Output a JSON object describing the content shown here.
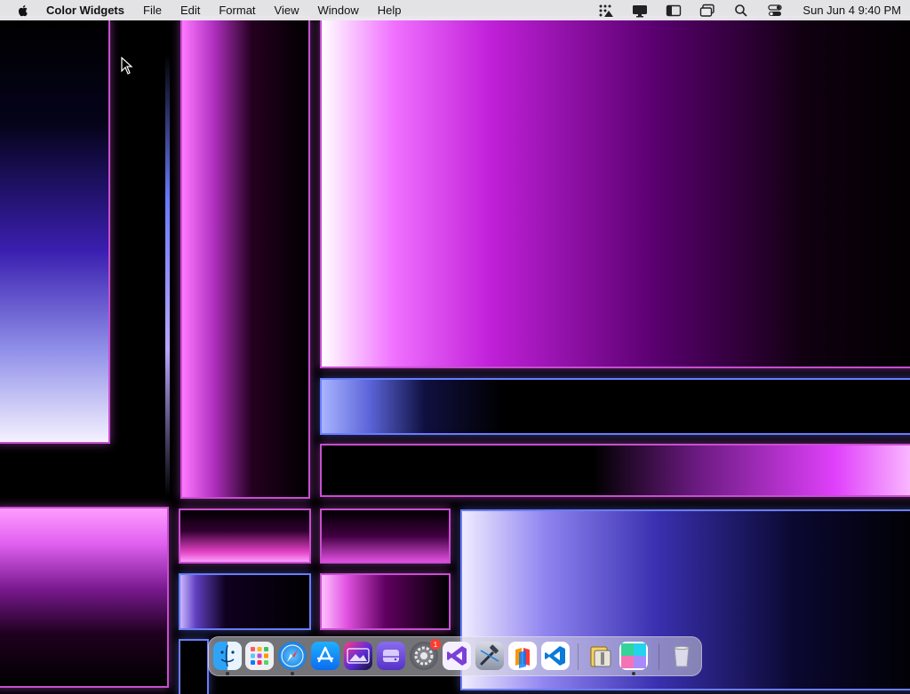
{
  "menubar": {
    "app_name": "Color Widgets",
    "menus": [
      "File",
      "Edit",
      "Format",
      "View",
      "Window",
      "Help"
    ],
    "status_icons": [
      "widget-grid-icon",
      "display-icon",
      "sidebar-icon",
      "window-stack-icon",
      "search-icon",
      "control-center-icon"
    ],
    "clock": "Sun Jun 4  9:40 PM"
  },
  "dock": {
    "apps": [
      {
        "name": "Finder",
        "icon": "finder-icon",
        "running": true
      },
      {
        "name": "Launchpad",
        "icon": "launchpad-icon",
        "running": false
      },
      {
        "name": "Safari",
        "icon": "safari-icon",
        "running": true
      },
      {
        "name": "App Store",
        "icon": "app-store-icon",
        "running": false
      },
      {
        "name": "Photo Editor HD",
        "icon": "photo-hd-icon",
        "running": false
      },
      {
        "name": "Storage",
        "icon": "disk-icon",
        "running": false
      },
      {
        "name": "System Settings",
        "icon": "gear-icon",
        "running": false,
        "badge": "1"
      },
      {
        "name": "Visual Studio",
        "icon": "visual-studio-icon",
        "running": false
      },
      {
        "name": "Xcode Tools",
        "icon": "hammer-icon",
        "running": false
      },
      {
        "name": "Books",
        "icon": "books-icon",
        "running": false
      },
      {
        "name": "VS Code",
        "icon": "vscode-icon",
        "running": false
      },
      {
        "name": "Archive Utility",
        "icon": "archive-icon",
        "running": false
      },
      {
        "name": "Color Widgets",
        "icon": "color-widgets-icon",
        "running": true
      },
      {
        "name": "Trash",
        "icon": "trash-icon",
        "running": false
      }
    ]
  },
  "colors": {
    "pink": "#e040fb",
    "violet": "#6a3df0",
    "blue": "#6a7cff",
    "menubar_bg": "#ececee"
  }
}
